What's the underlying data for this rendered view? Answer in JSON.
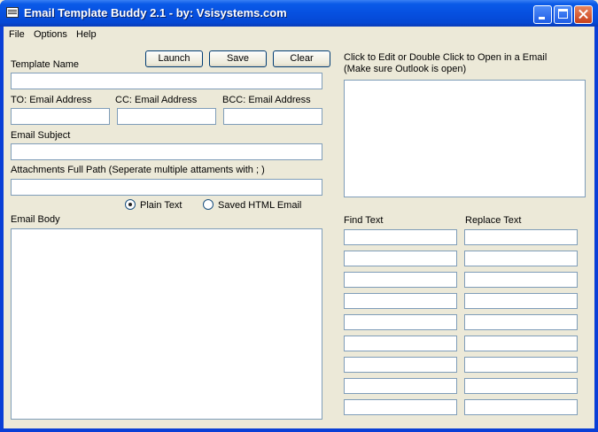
{
  "window": {
    "title": "Email Template Buddy 2.1 - by: Vsisystems.com"
  },
  "menu": {
    "file": "File",
    "options": "Options",
    "help": "Help"
  },
  "buttons": {
    "launch": "Launch",
    "save": "Save",
    "clear": "Clear"
  },
  "labels": {
    "template_name": "Template Name",
    "to": "TO: Email Address",
    "cc": "CC: Email Address",
    "bcc": "BCC: Email Address",
    "subject": "Email Subject",
    "attachments": "Attachments Full Path (Seperate multiple attaments with ; )",
    "body": "Email Body",
    "list_hint_1": "Click to Edit or Double Click to Open in a Email",
    "list_hint_2": "(Make sure Outlook is open)",
    "find_text": "Find Text",
    "replace_text": "Replace Text"
  },
  "format": {
    "plain_text": "Plain Text",
    "saved_html": "Saved HTML Email",
    "selected": "plain_text"
  },
  "fields": {
    "template_name": "",
    "to": "",
    "cc": "",
    "bcc": "",
    "subject": "",
    "attachments": "",
    "body": ""
  },
  "find_replace_rows": 9
}
